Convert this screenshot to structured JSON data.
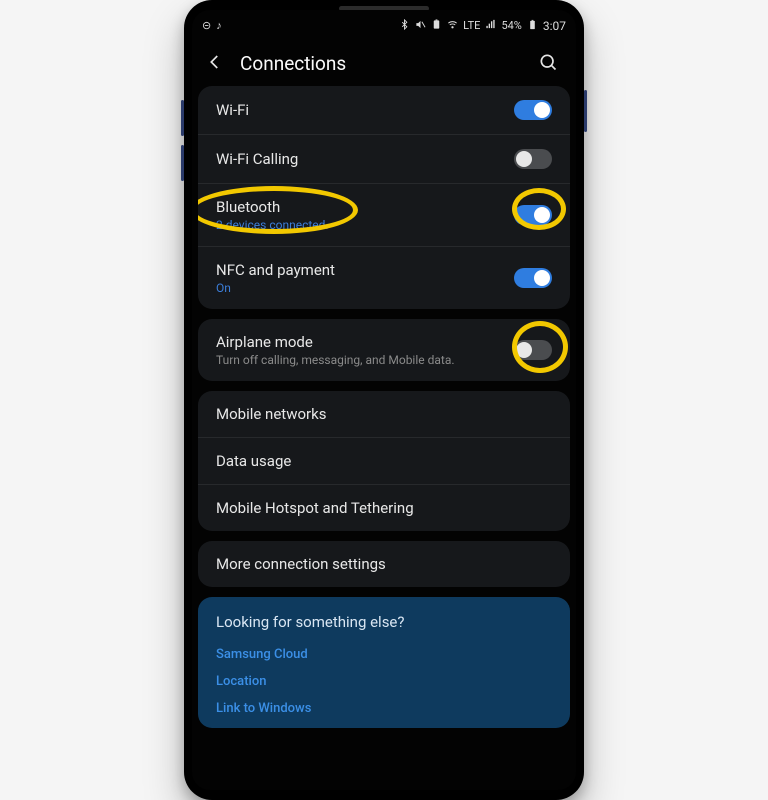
{
  "status": {
    "battery": "54%",
    "time": "3:07",
    "lte": "LTE"
  },
  "header": {
    "title": "Connections"
  },
  "rows": {
    "wifi": {
      "title": "Wi-Fi"
    },
    "wificall": {
      "title": "Wi-Fi Calling"
    },
    "bluetooth": {
      "title": "Bluetooth",
      "sub": "2 devices connected."
    },
    "nfc": {
      "title": "NFC and payment",
      "sub": "On"
    },
    "airplane": {
      "title": "Airplane mode",
      "sub": "Turn off calling, messaging, and Mobile data."
    },
    "mobilenet": {
      "title": "Mobile networks"
    },
    "datausage": {
      "title": "Data usage"
    },
    "hotspot": {
      "title": "Mobile Hotspot and Tethering"
    },
    "more": {
      "title": "More connection settings"
    }
  },
  "suggest": {
    "question": "Looking for something else?",
    "links": {
      "l1": "Samsung Cloud",
      "l2": "Location",
      "l3": "Link to Windows"
    }
  },
  "colors": {
    "accent": "#2f7de0",
    "highlight": "#f2c800"
  }
}
